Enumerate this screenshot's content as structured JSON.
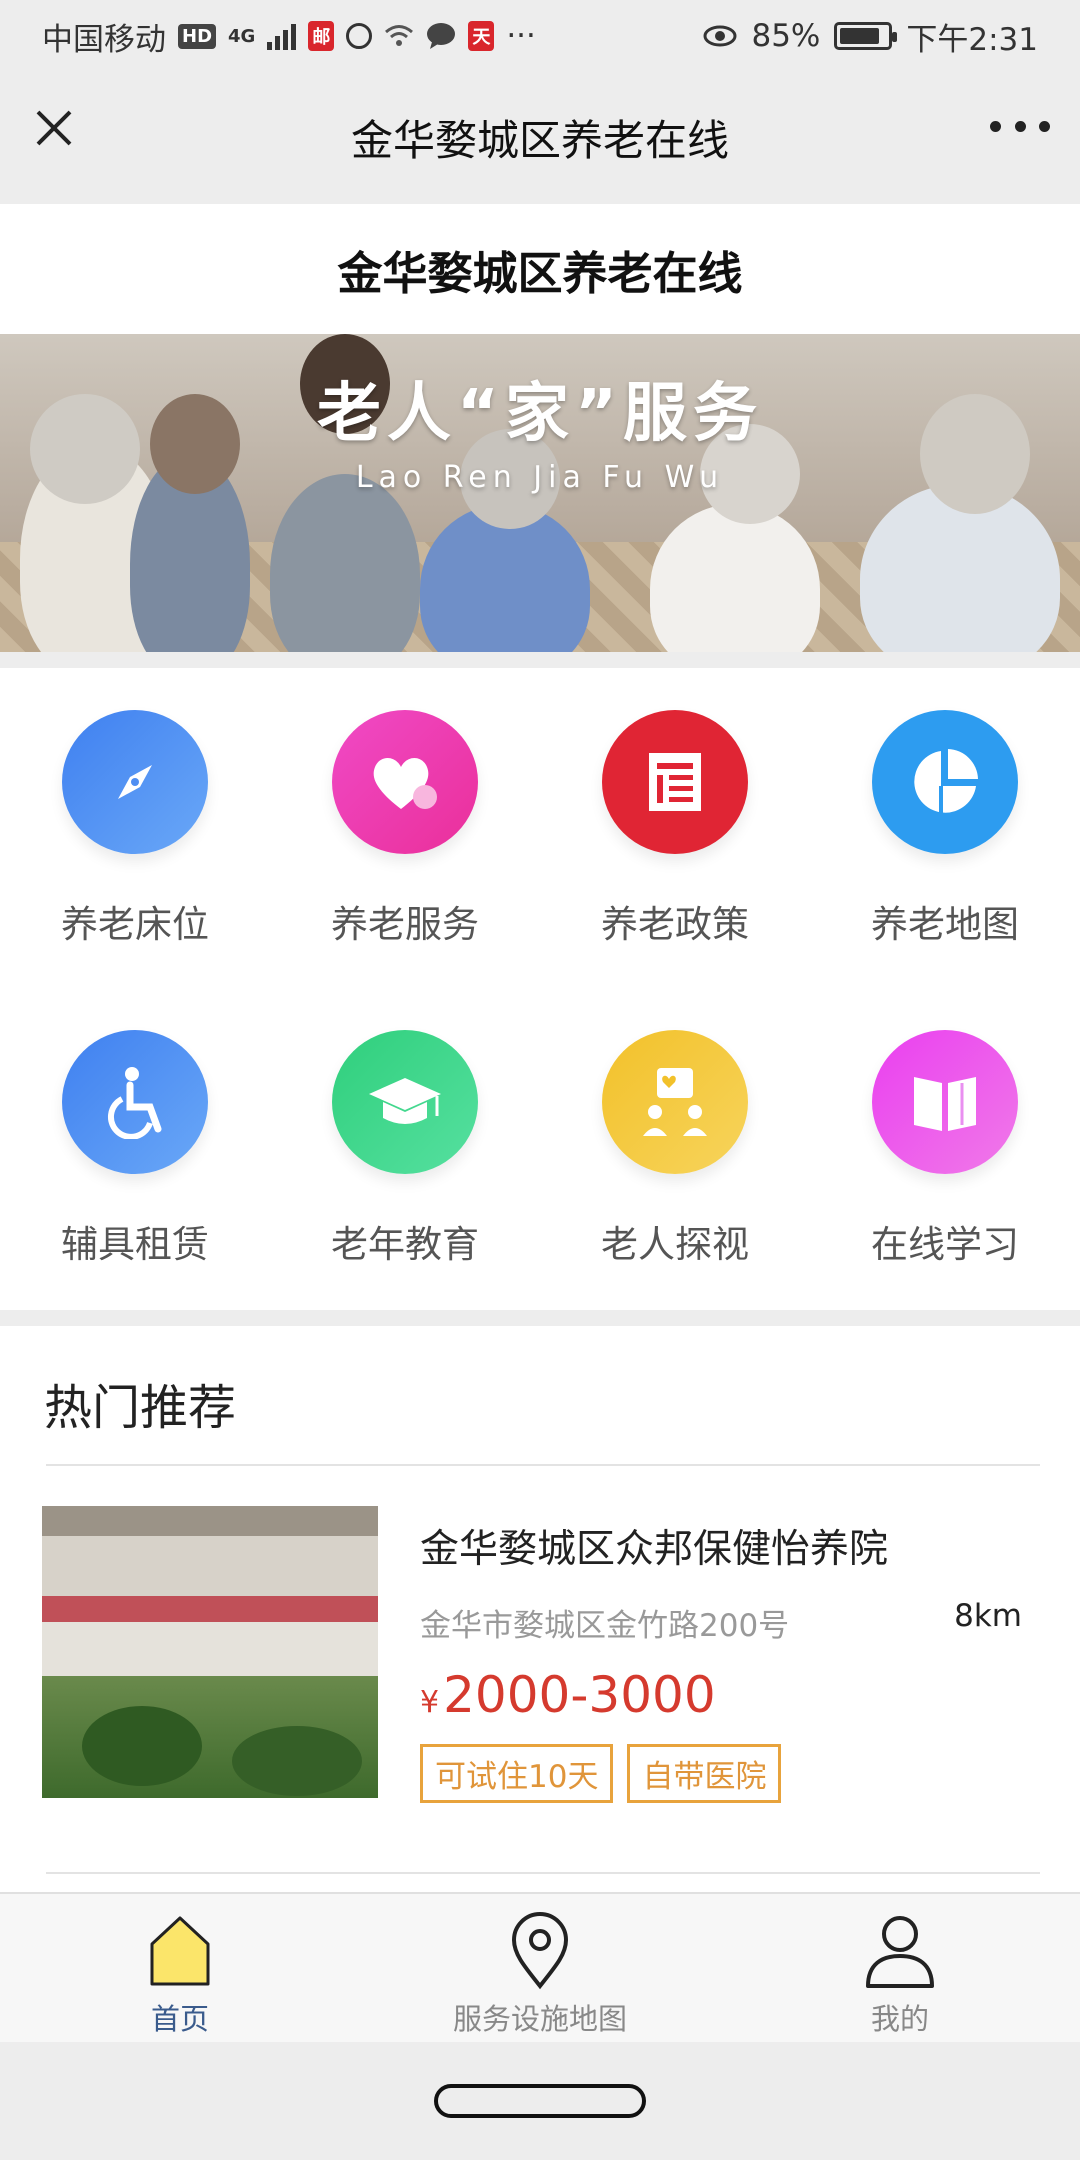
{
  "status_bar": {
    "carrier": "中国移动",
    "hd_badge": "HD",
    "network": "4G",
    "battery_percent": "85%",
    "battery_level": 0.85,
    "time": "下午2:31"
  },
  "nav_bar": {
    "title": "金华婺城区养老在线",
    "close_icon": "close-icon",
    "more_icon": "more-icon"
  },
  "page": {
    "title": "金华婺城区养老在线"
  },
  "banner": {
    "title": "老人“家”服务",
    "subtitle": "Lao Ren Jia Fu Wu"
  },
  "grid": {
    "items": [
      {
        "label": "养老床位",
        "icon": "compass-icon",
        "color": "#4f8ef2"
      },
      {
        "label": "养老服务",
        "icon": "heart-icon",
        "color": "#e93db3"
      },
      {
        "label": "养老政策",
        "icon": "document-icon",
        "color": "#e02534"
      },
      {
        "label": "养老地图",
        "icon": "pie-chart-icon",
        "color": "#2d9cf0"
      },
      {
        "label": "辅具租赁",
        "icon": "wheelchair-icon",
        "color": "#4a8ff0"
      },
      {
        "label": "老年教育",
        "icon": "graduation-cap-icon",
        "color": "#34d182"
      },
      {
        "label": "老人探视",
        "icon": "visit-icon",
        "color": "#f4c531"
      },
      {
        "label": "在线学习",
        "icon": "book-icon",
        "color": "#e24fe6"
      }
    ]
  },
  "recommendation": {
    "heading": "热门推荐",
    "item": {
      "name": "金华婺城区众邦保健怡养院",
      "address": "金华市婺城区金竹路200号",
      "distance": "8km",
      "currency": "¥",
      "price": "2000-3000",
      "tags": [
        "可试住10天",
        "自带医院"
      ]
    }
  },
  "tab_bar": {
    "items": [
      {
        "label": "首页",
        "icon": "home-icon",
        "active": true
      },
      {
        "label": "服务设施地图",
        "icon": "location-pin-icon",
        "active": false
      },
      {
        "label": "我的",
        "icon": "user-icon",
        "active": false
      }
    ]
  },
  "colors": {
    "accent_tab": "#3a5b8c",
    "price": "#d53a2e",
    "tag_border": "#e8a33c",
    "home_icon_fill": "#fbe56a"
  }
}
